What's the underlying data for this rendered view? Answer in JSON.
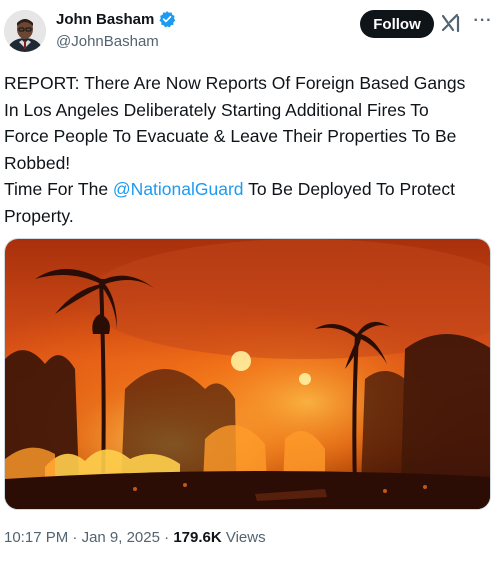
{
  "author": {
    "display_name": "John Basham",
    "handle": "@JohnBasham",
    "verified": true,
    "avatar_icon": "profile-photo"
  },
  "actions": {
    "follow_label": "Follow",
    "grok_icon": "grok-icon",
    "more_icon": "more-icon",
    "more_glyph": "···"
  },
  "tweet": {
    "text_before": "REPORT: There Are Now Reports Of Foreign Based Gangs\nIn Los Angeles Deliberately Starting Additional Fires To\nForce People To Evacuate & Leave Their Properties To Be\nRobbed!\nTime For The ",
    "mention": "@NationalGuard",
    "text_after": " To Be Deployed To Protect\nProperty."
  },
  "media": {
    "type": "photo",
    "icon": "wildfire-photo"
  },
  "meta": {
    "time": "10:17 PM",
    "sep1": " · ",
    "date": "Jan 9, 2025",
    "sep2": " · ",
    "views_count": "179.6K",
    "views_label": " Views"
  },
  "colors": {
    "accent": "#1d9bf0",
    "text": "#0f1419",
    "secondary": "#536471",
    "follow_bg": "#0f1419"
  }
}
